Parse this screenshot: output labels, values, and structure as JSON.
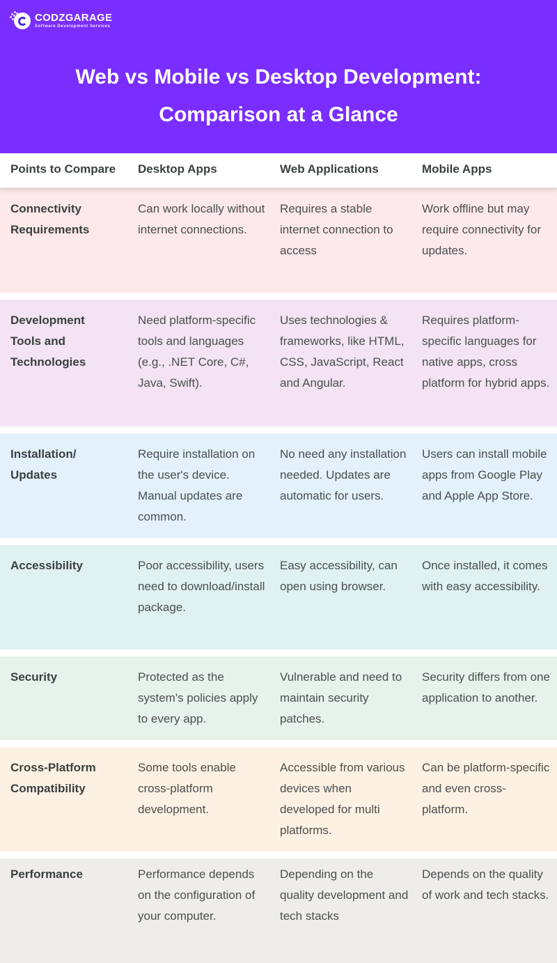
{
  "brand": {
    "name": "CODZGARAGE",
    "tagline": "Software Development Services",
    "header_color": "#7a2dff"
  },
  "title": {
    "line1": "Web vs Mobile vs Desktop Development:",
    "line2": "Comparison at a Glance"
  },
  "table": {
    "headers": [
      "Points to Compare",
      "Desktop Apps",
      "Web Applications",
      "Mobile Apps"
    ],
    "rows": [
      {
        "point": "Connectivity Requirements",
        "color": "#fde8ea",
        "desktop": "Can work locally without internet connections.",
        "web": "Requires a stable internet connection to access",
        "mobile": "Work offline but may require connectivity for updates."
      },
      {
        "point": "Development Tools and Technologies",
        "color": "#f3e3f4",
        "desktop": "Need platform-specific tools and languages (e.g., .NET Core, C#, Java, Swift).",
        "web": "Uses technologies & frameworks, like HTML, CSS, JavaScript, React and Angular.",
        "mobile": "Requires platform-specific languages for native apps, cross platform for hybrid apps."
      },
      {
        "point": "Installation/ Updates",
        "color": "#e2f1fb",
        "desktop": "Require installation on the user's device. Manual updates are common.",
        "web": "No need any installation needed. Updates are automatic for users.",
        "mobile": "Users can install mobile apps from Google Play and Apple App Store."
      },
      {
        "point": "Accessibility",
        "color": "#dff1f1",
        "desktop": "Poor accessibility, users need to download/install package.",
        "web": "Easy accessibility, can open using browser.",
        "mobile": "Once installed, it comes with easy accessibility."
      },
      {
        "point": "Security",
        "color": "#e6f3ea",
        "desktop": "Protected as the system's policies apply to every app.",
        "web": "Vulnerable and need to maintain security patches.",
        "mobile": "Security differs from one application to another."
      },
      {
        "point": "Cross-Platform Compatibility",
        "color": "#fdf1e3",
        "desktop": "Some tools enable cross-platform development.",
        "web": "Accessible from various devices when developed for multi platforms.",
        "mobile": "Can be platform-specific and even cross-platform."
      },
      {
        "point": "Performance",
        "color": "#efedeb",
        "desktop": "Performance depends on the configuration of your computer.",
        "web": "Depending on the quality development and tech stacks",
        "mobile": "Depends on the quality of work and tech stacks."
      }
    ]
  }
}
